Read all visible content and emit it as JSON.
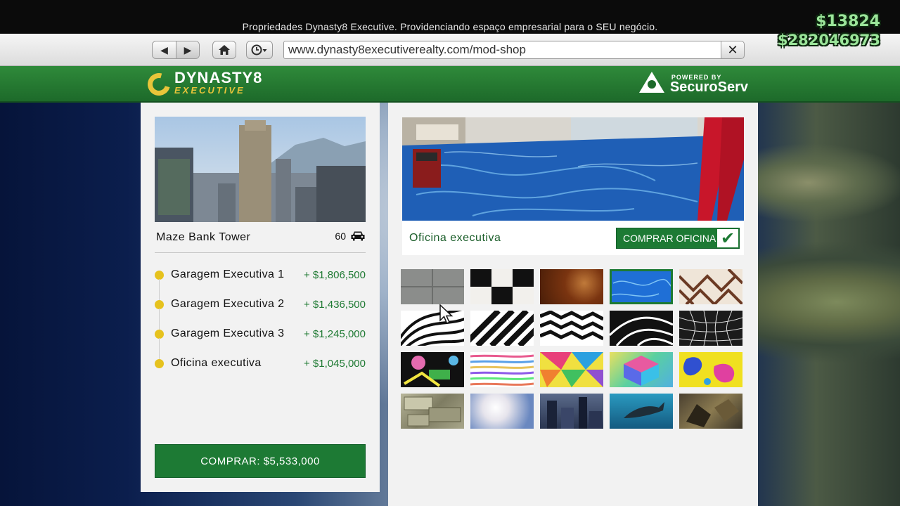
{
  "top_bar": {
    "title": "Propriedades Dynasty8 Executive. Providenciando espaço empresarial para o SEU negócio."
  },
  "hud": {
    "cash": "$13824",
    "bank": "$282046973",
    "color": "#9be59a"
  },
  "browser": {
    "back_icon": "back-arrow-icon",
    "forward_icon": "forward-arrow-icon",
    "home_icon": "home-icon",
    "history_icon": "clock-icon",
    "url": "www.dynasty8executiverealty.com/mod-shop",
    "close_icon": "close-icon"
  },
  "header": {
    "logo_line1": "DYNASTY8",
    "logo_line2": "EXECUTIVE",
    "powered_by": "POWERED BY",
    "powered_brand": "SecuroServ",
    "brand_green": "#1d6a2a",
    "logo_gold": "#e9c53a"
  },
  "property": {
    "name": "Maze Bank Tower",
    "capacity": "60",
    "capacity_icon": "car-icon",
    "items": [
      {
        "name": "Garagem Executiva 1",
        "price": "+ $1,806,500"
      },
      {
        "name": "Garagem Executiva 2",
        "price": "+ $1,436,500"
      },
      {
        "name": "Garagem Executiva 3",
        "price": "+ $1,245,000"
      },
      {
        "name": "Oficina executiva",
        "price": "+ $1,045,000"
      }
    ],
    "buy_label": "COMPRAR: $5,533,000",
    "accent_green": "#1d7a34",
    "bullet_color": "#e6c21e"
  },
  "workshop": {
    "label": "Oficina executiva",
    "buy_label": "COMPRAR OFICINA",
    "selected_swatch": 3,
    "swatches": [
      "grey-tile",
      "black-white-checker",
      "rust",
      "blue-water",
      "maze-pattern",
      "zebra-stripes",
      "diagonal-stripes",
      "wavy-zebra",
      "black-swirl",
      "grid-warp",
      "graffiti",
      "pastel-stripes",
      "geometric-color",
      "color-cube",
      "paint-splash",
      "money",
      "clouds",
      "city",
      "shark",
      "rocks"
    ]
  }
}
